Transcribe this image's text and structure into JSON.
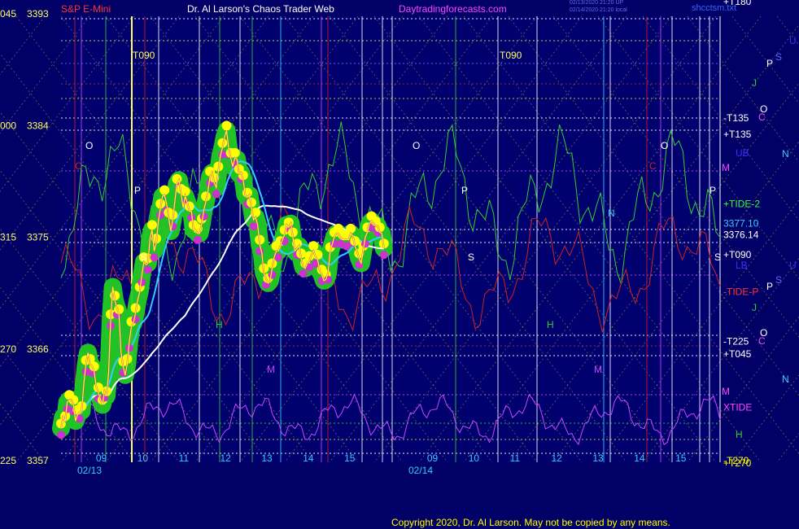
{
  "header": {
    "instrument": "S&P E-Mini",
    "title": "Dr. Al Larson's Chaos Trader Web",
    "site": "Daytradingforecasts.com",
    "timestamp1": "02/13/2020 21:20 UP",
    "timestamp2": "02/14/2020 21:20 local",
    "source": "shcctsm.txt"
  },
  "footer": {
    "copyright": "Copyright 2020, Dr. Al Larson. May not be copied by any means."
  },
  "colors": {
    "background": "#000066",
    "plot_bg": "#000080",
    "price_band": "#22cc22",
    "price_dots": "#ffff00",
    "lows": "#cc33cc",
    "ma_fast": "#33ccff",
    "ma_slow": "#ffffff",
    "tide": "#cc2222",
    "xtide": "#cc44ff",
    "green_line": "#33cc33"
  },
  "chart_data": {
    "type": "line",
    "title": "S&P E-Mini",
    "y_labels": [
      {
        "left": "045",
        "price": "3393",
        "value": 3393
      },
      {
        "left": "000",
        "price": "3384",
        "value": 3384
      },
      {
        "left": "315",
        "price": "3375",
        "value": 3375
      },
      {
        "left": "270",
        "price": "3366",
        "value": 3366
      },
      {
        "left": "225",
        "price": "3357",
        "value": 3357
      }
    ],
    "ylim": [
      3357,
      3393
    ],
    "day1": {
      "date": "02/13",
      "hours": [
        "09",
        "10",
        "11",
        "12",
        "13",
        "14",
        "15"
      ],
      "price_x": [
        0.0,
        0.05,
        0.1,
        0.15,
        0.2,
        0.25,
        0.3,
        0.35,
        0.4,
        0.45,
        0.5,
        0.55,
        0.6,
        0.65,
        0.7,
        0.75,
        0.8,
        0.85,
        0.9,
        0.95,
        1.0,
        1.05,
        1.1,
        1.15,
        1.2,
        1.25,
        1.3,
        1.35,
        1.4,
        1.45,
        1.5,
        1.55,
        1.6,
        1.65,
        1.7,
        1.75,
        1.8,
        1.85,
        1.9,
        1.95,
        2.0,
        2.05,
        2.1,
        2.15,
        2.2,
        2.25,
        2.3,
        2.35,
        2.4,
        2.45,
        2.5,
        2.55,
        2.6,
        2.65,
        2.7,
        2.75,
        2.8,
        2.85,
        2.9,
        2.95,
        3.0,
        3.05,
        3.1,
        3.15,
        3.2,
        3.25,
        3.3,
        3.35,
        3.4,
        3.45,
        3.5,
        3.55,
        3.6,
        3.65,
        3.7,
        3.75,
        3.8,
        3.85,
        3.9,
        3.95,
        4.0,
        4.05,
        4.1,
        4.15,
        4.2,
        4.25,
        4.3,
        4.35,
        4.4,
        4.45,
        4.5,
        4.55,
        4.6,
        4.65,
        4.7,
        4.75,
        4.8,
        4.85,
        4.9,
        4.95,
        5.0,
        5.05,
        5.1,
        5.15,
        5.2,
        5.25,
        5.3,
        5.35,
        5.4,
        5.45,
        5.5,
        5.55,
        5.6,
        5.65,
        5.7,
        5.75,
        5.8,
        5.85,
        5.9,
        5.95,
        6.0,
        6.05,
        6.1,
        6.15,
        6.2,
        6.25,
        6.3,
        6.35,
        6.4,
        6.45,
        6.5,
        6.55,
        6.6,
        6.65,
        6.7,
        6.75,
        6.8,
        6.85,
        6.9,
        6.95,
        7.0,
        7.05,
        7.1,
        7.15,
        7.2,
        7.25,
        7.3,
        7.35,
        7.4,
        7.45,
        7.5,
        7.55,
        7.6,
        7.65,
        7.7,
        7.75,
        7.8
      ],
      "price": [
        3359.6,
        3360.5,
        3360.2,
        3361.7,
        3361.9,
        3361.9,
        3361.5,
        3360.2,
        3360.7,
        3360.9,
        3361.0,
        3363.2,
        3364.7,
        3365.7,
        3364.8,
        3364.6,
        3364.2,
        3363.0,
        3362.5,
        3362.0,
        3361.5,
        3362.6,
        3362.2,
        3364.1,
        3368.4,
        3371.0,
        3369.9,
        3369.3,
        3368.8,
        3365.7,
        3364.6,
        3363.9,
        3364.8,
        3366.6,
        3367.8,
        3368.1,
        3368.9,
        3369.9,
        3370.6,
        3371.9,
        3373.0,
        3372.8,
        3372.9,
        3374.9,
        3375.6,
        3373.9,
        3374.5,
        3376.3,
        3377.3,
        3378.3,
        3378.4,
        3377.7,
        3376.6,
        3375.5,
        3376.4,
        3377.9,
        3379.3,
        3379.6,
        3378.5,
        3377.4,
        3378.3,
        3377.8,
        3377.1,
        3377.1,
        3375.6,
        3375.6,
        3375.3,
        3375.3,
        3376.1,
        3377.2,
        3377.9,
        3378.7,
        3379.9,
        3380.2,
        3379.4,
        3379.0,
        3380.3,
        3381.6,
        3382.2,
        3383.1,
        3383.6,
        3382.2,
        3381.4,
        3380.7,
        3381.4,
        3381.3,
        3380.1,
        3380.2,
        3379.6,
        3378.4,
        3378.2,
        3378.4,
        3377.4,
        3376.4,
        3376.6,
        3376.0,
        3374.4,
        3373.8,
        3372.1,
        3371.7,
        3371.3,
        3371.5,
        3372.5,
        3373.4,
        3373.9,
        3373.9,
        3374.3,
        3374.8,
        3375.2,
        3376.0,
        3375.8,
        3376.1,
        3375.0,
        3373.9,
        3374.1,
        3374.3,
        3373.3,
        3372.6,
        3372.5,
        3372.9,
        3373.1,
        3373.6,
        3373.9,
        3373.4,
        3373.2,
        3372.3,
        3372.0,
        3371.5,
        3371.6,
        3372.1,
        3373.8,
        3374.4,
        3375.0,
        3375.3,
        3375.3,
        3375.0,
        3374.8,
        3374.8,
        3374.8,
        3374.8,
        3375.3,
        3375.1,
        3374.3,
        3373.9,
        3373.3,
        3372.9,
        3373.9,
        3375.0,
        3375.4,
        3376.1,
        3376.3,
        3376.1,
        3375.9,
        3375.9,
        3375.4,
        3375.3,
        3374.1
      ]
    },
    "day2": {
      "date": "02/14",
      "hours": [
        "09",
        "10",
        "11",
        "12",
        "13",
        "14",
        "15"
      ]
    },
    "right_labels": [
      {
        "text": "+T180",
        "value": 3394.0,
        "color": "#ffffff"
      },
      {
        "text": "-T135",
        "value": 3384.6,
        "color": "#ffffff"
      },
      {
        "text": "+T135",
        "value": 3383.3,
        "color": "#ffffff"
      },
      {
        "text": "+TIDE-2",
        "value": 3377.7,
        "color": "#33ff33"
      },
      {
        "text": "3377.10",
        "value": 3376.1,
        "color": "#33ccff"
      },
      {
        "text": "3376.14",
        "value": 3375.2,
        "color": "#ffffff"
      },
      {
        "text": "+T090",
        "value": 3373.6,
        "color": "#ffffff"
      },
      {
        "text": "-TIDE-P",
        "value": 3370.6,
        "color": "#ff3333"
      },
      {
        "text": "-T225",
        "value": 3366.6,
        "color": "#ffffff"
      },
      {
        "text": "+T045",
        "value": 3365.6,
        "color": "#ffffff"
      },
      {
        "text": "XTIDE",
        "value": 3361.3,
        "color": "#ff44ff"
      },
      {
        "text": "-T270",
        "value": 3357.0,
        "color": "#ffff00"
      },
      {
        "text": "+T270",
        "value": 3356.8,
        "color": "#ffff00"
      }
    ],
    "markers": [
      "O",
      "P",
      "S",
      "J",
      "H",
      "M",
      "N",
      "C",
      "T",
      "T090"
    ],
    "grid": true
  }
}
